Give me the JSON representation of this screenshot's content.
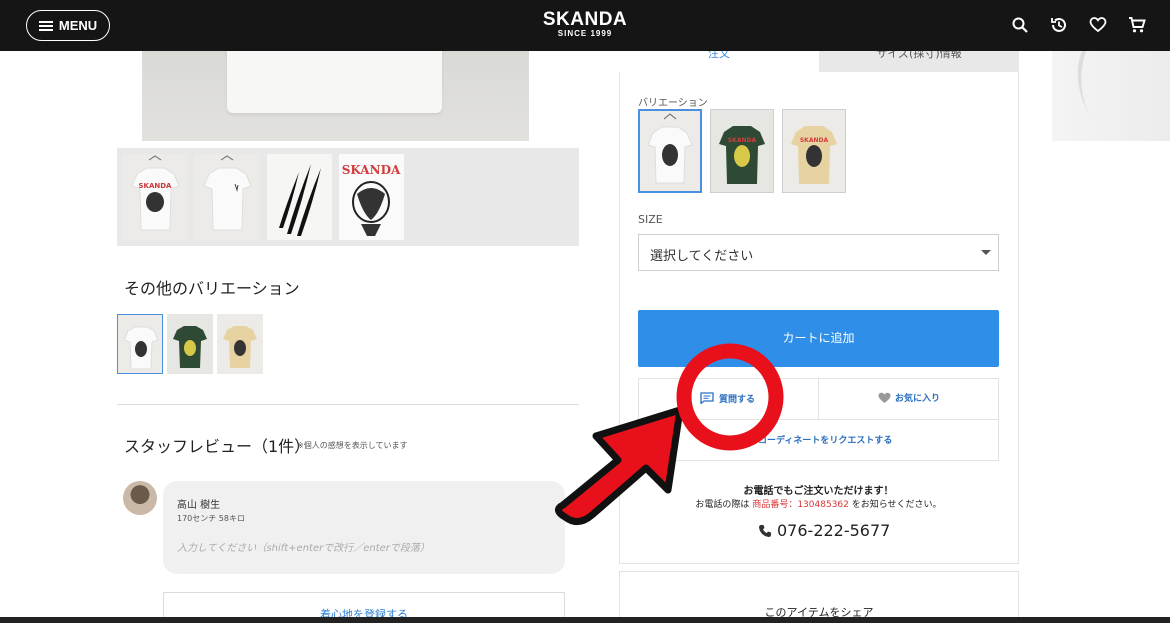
{
  "header": {
    "menu_label": "MENU",
    "logo_main": "SKANDA",
    "logo_sub": "SINCE 1999",
    "icons": [
      "search-icon",
      "history-icon",
      "heart-icon",
      "cart-icon"
    ]
  },
  "left": {
    "thumbnails": [
      "front-print",
      "back-plain",
      "claw-marks",
      "skanda-print"
    ],
    "other_variations_title": "その他のバリエーション",
    "variation_colors": [
      "#f3f3f1",
      "#2f4a34",
      "#e7d2a2"
    ],
    "staff_review_title": "スタッフレビュー（1件）",
    "staff_review_note": "※個人の感想を表示しています",
    "reviewer_name": "高山 樹生",
    "reviewer_spec": "170センチ 58キロ",
    "review_placeholder": "入力してください（shift+enterで改行／enterで段落）",
    "register_button": "着心地を登録する"
  },
  "right": {
    "tab_order": "注文",
    "tab_size": "サイズ(採寸)情報",
    "variation_label": "バリエーション",
    "swatch_colors": [
      "#f3f3f1",
      "#2f4a34",
      "#e7d2a2"
    ],
    "size_label": "SIZE",
    "size_select_value": "選択してください",
    "cart_button": "カートに追加",
    "question_button": "質問する",
    "favorite_button": "お気に入り",
    "coordinate_button": "コーディネートをリクエストする",
    "phone_note_title": "お電話でもご注文いただけます！",
    "phone_note_prefix": "お電話の際は",
    "phone_note_item": "商品番号：130485362",
    "phone_note_suffix": "をお知らせください。",
    "phone_number": "076-222-5677",
    "share_label": "このアイテムをシェア"
  },
  "colors": {
    "header_bg": "#151515",
    "accent_blue": "#2e8ee8",
    "annotation_red": "#e8101a"
  }
}
